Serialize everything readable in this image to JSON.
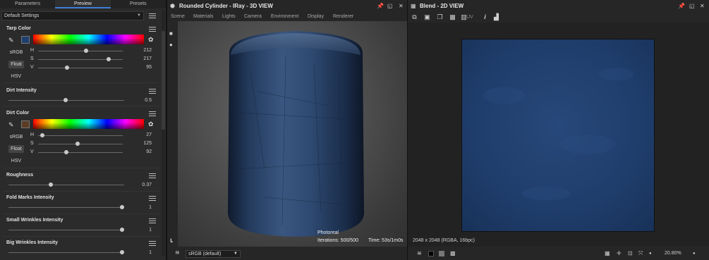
{
  "left_panel": {
    "tabs": [
      "Parameters",
      "Preview",
      "Presets"
    ],
    "active_tab": "Preview",
    "preset": "Default Settings",
    "tarp_color": {
      "title": "Tarp Color",
      "swatch": "#1e3f70",
      "modes": [
        "sRGB",
        "Float",
        "HSV"
      ],
      "selected_mode": "Float",
      "channels": [
        {
          "label": "H",
          "value": "212",
          "fraction": 0.59
        },
        {
          "label": "S",
          "value": "217",
          "fraction": 0.85
        },
        {
          "label": "V",
          "value": "95",
          "fraction": 0.37
        }
      ]
    },
    "dirt_intensity": {
      "title": "Dirt Intensity",
      "value": "0.5",
      "fraction": 0.5
    },
    "dirt_color": {
      "title": "Dirt Color",
      "swatch": "#5c3c24",
      "modes": [
        "sRGB",
        "Float",
        "HSV"
      ],
      "selected_mode": "Float",
      "channels": [
        {
          "label": "H",
          "value": "27",
          "fraction": 0.08
        },
        {
          "label": "S",
          "value": "125",
          "fraction": 0.49
        },
        {
          "label": "V",
          "value": "92",
          "fraction": 0.36
        }
      ]
    },
    "roughness": {
      "title": "Roughness",
      "value": "0.37",
      "fraction": 0.37
    },
    "fold_marks": {
      "title": "Fold Marks Intensity",
      "value": "1",
      "fraction": 1.0
    },
    "small_wrinkles": {
      "title": "Small Wrinkles Intensity",
      "value": "1",
      "fraction": 1.0
    },
    "big_wrinkles": {
      "title": "Big Wrinkles Intensity",
      "value": "1",
      "fraction": 1.0
    }
  },
  "view3d": {
    "title": "Rounded Cylinder - IRay - 3D VIEW",
    "menu": [
      "Scene",
      "Materials",
      "Lights",
      "Camera",
      "Environment",
      "Display",
      "Renderer"
    ],
    "overlay_mode": "Photoreal",
    "iterations": "Iterations: 500/500",
    "time": "Time: 53s/1m0s",
    "colorspace": "sRGB (default)"
  },
  "view2d": {
    "title": "Blend - 2D VIEW",
    "uv_label": "UV",
    "info": "2048 x 2048 (RGBA, 16bpc)",
    "zoom": "20.80%",
    "texture_color": "#1d3a66"
  }
}
